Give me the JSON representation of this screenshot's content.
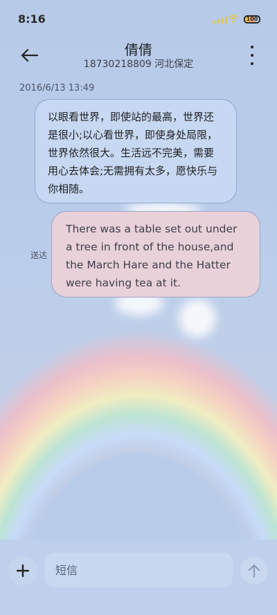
{
  "status_bar": {
    "time": "8:16",
    "battery": "100"
  },
  "header": {
    "contact_name": "倩倩",
    "contact_detail": "18730218809 河北保定"
  },
  "thread": {
    "timestamp": "2016/6/13 13:49",
    "received": {
      "text": "以眼看世界，即使站的最高，世界还是很小;以心看世界，即使身处局限，世界依然很大。生活远不完美，需要用心去体会;无需拥有太多，愿快乐与你相随。"
    },
    "sent": {
      "text": "There was a table set out under a tree in front of the house,and the March Hare and the Hatter were having tea at it.",
      "status": "送达"
    }
  },
  "composer": {
    "placeholder": "短信",
    "add_icon": "plus-icon",
    "send_icon": "arrow-up-icon"
  },
  "icons": {
    "back": "arrow-left-icon",
    "more": "more-vertical-icon"
  },
  "colors": {
    "background": "#b9cdeb",
    "received_bubble": "#c7d8f3",
    "sent_bubble": "#e9d1d9"
  }
}
